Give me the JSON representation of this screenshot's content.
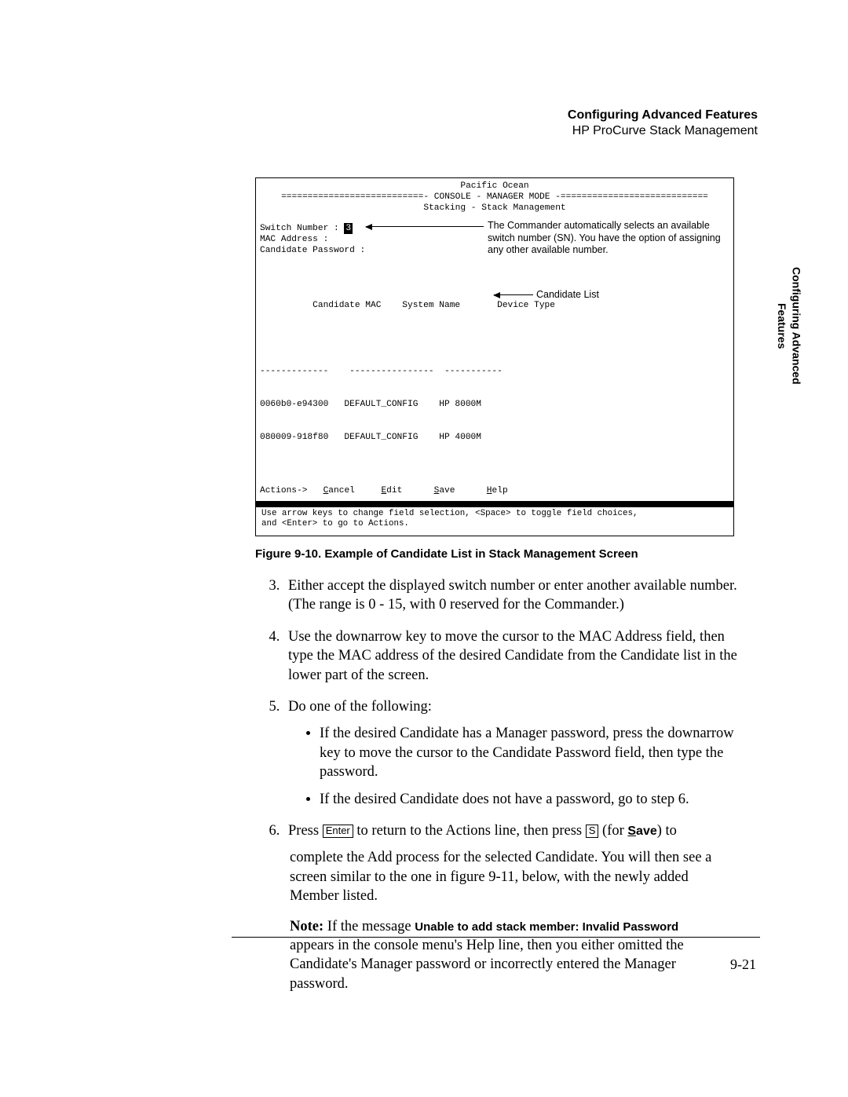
{
  "header": {
    "title": "Configuring Advanced Features",
    "subtitle": "HP ProCurve Stack Management"
  },
  "side_tab": {
    "line1": "Configuring Advanced",
    "line2": "Features"
  },
  "console": {
    "top_title": "Pacific Ocean",
    "mode_line": "===========================- CONSOLE - MANAGER MODE -============================",
    "sub_line": "Stacking - Stack Management",
    "fields": {
      "switch_number_label": "Switch Number : ",
      "switch_number_value": "3",
      "mac_label": "MAC Address :",
      "pwd_label": "Candidate Password :"
    },
    "callouts": {
      "sn": "The Commander automatically selects an available switch number (SN). You have the option of assigning any other available number.",
      "list": "Candidate List"
    },
    "table": {
      "header": "Candidate MAC    System Name       Device Type",
      "divider": "-------------    ----------------  -----------",
      "rows": [
        "0060b0-e94300   DEFAULT_CONFIG    HP 8000M",
        "080009-918f80   DEFAULT_CONFIG    HP 4000M"
      ]
    },
    "actions": {
      "prefix": "Actions->   ",
      "cancel": "Cancel",
      "edit": "Edit",
      "save": "Save",
      "help": "Help"
    },
    "help_text": "Use arrow keys to change field selection, <Space> to toggle field choices,\nand <Enter> to go to Actions."
  },
  "figure_caption": "Figure 9-10.  Example of Candidate List in Stack Management Screen",
  "steps": {
    "s3": "Either accept the displayed switch number or enter another available number. (The range is 0 - 15, with 0 reserved for the Commander.)",
    "s4": "Use the downarrow key to move the cursor to the MAC Address field, then type the MAC address of the desired Candidate from the Candidate list in the lower part of the screen.",
    "s5_intro": "Do one of the following:",
    "s5_b1": "If the desired Candidate has a Manager password, press the downarrow key to move the cursor to the Candidate Password field, then type the password.",
    "s5_b2": "If the desired Candidate does not have a password, go to step 6.",
    "s6_a": "Press ",
    "s6_key1": "Enter",
    "s6_b": " to return to the Actions line, then press ",
    "s6_key2": "S",
    "s6_c": " (for ",
    "s6_save": "Save",
    "s6_d": ") to",
    "s6_tail": "complete the Add process for the selected Candidate. You will then see a screen similar to the one in figure 9-11, below, with the newly added Member listed."
  },
  "note": {
    "label": "Note:",
    "msg": " If the message ",
    "bold_msg": "Unable to add stack member: Invalid Password",
    "tail": " appears in the console menu's Help line, then you either omitted the Candidate's Manager password or incorrectly entered the Manager password."
  },
  "page_number": "9-21"
}
